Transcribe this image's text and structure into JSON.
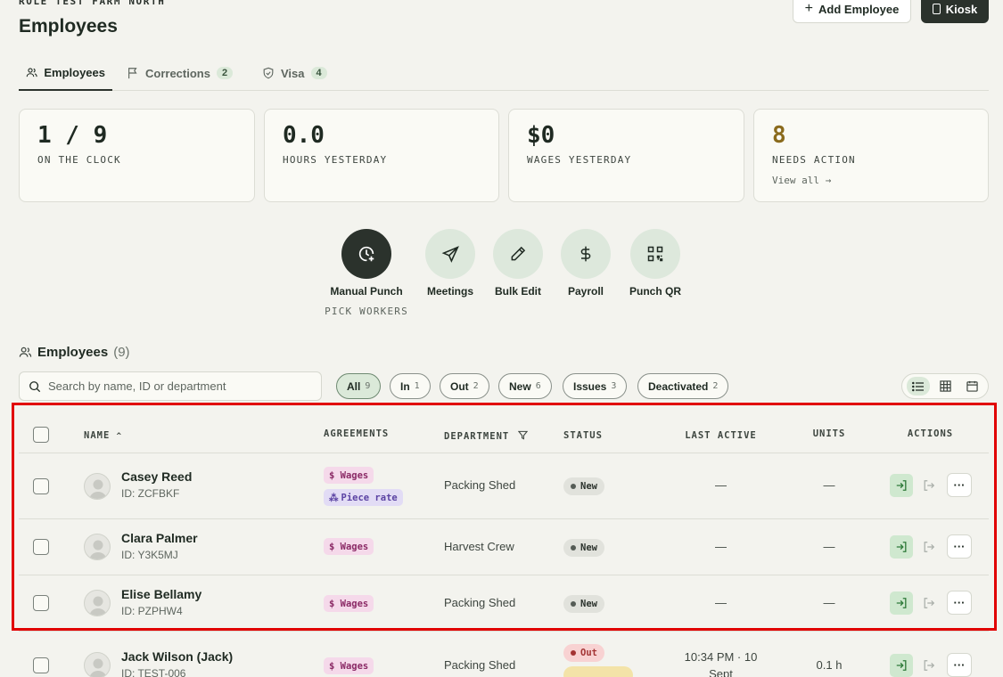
{
  "header": {
    "org": "ROLE TEST FARM NORTH",
    "title": "Employees",
    "add_employee": "Add Employee",
    "kiosk": "Kiosk"
  },
  "tabs": [
    {
      "label": "Employees",
      "icon": "people-icon"
    },
    {
      "label": "Corrections",
      "count": "2",
      "icon": "flag-icon"
    },
    {
      "label": "Visa",
      "count": "4",
      "icon": "shield-icon"
    }
  ],
  "stats": [
    {
      "value": "1 / 9",
      "label": "ON THE CLOCK"
    },
    {
      "value": "0.0",
      "label": "HOURS YESTERDAY"
    },
    {
      "value": "$0",
      "label": "WAGES YESTERDAY"
    },
    {
      "value": "8",
      "label": "NEEDS ACTION",
      "link": "View all →",
      "color": "#8a6a1c"
    }
  ],
  "actions": [
    {
      "label": "Manual Punch",
      "sub": "PICK WORKERS",
      "icon": "clock-plus-icon"
    },
    {
      "label": "Meetings",
      "icon": "send-icon"
    },
    {
      "label": "Bulk Edit",
      "icon": "pencil-icon"
    },
    {
      "label": "Payroll",
      "icon": "dollar-icon"
    },
    {
      "label": "Punch QR",
      "icon": "qr-code-icon"
    }
  ],
  "section": {
    "title": "Employees",
    "count": "(9)"
  },
  "search": {
    "placeholder": "Search by name, ID or department"
  },
  "filters": [
    {
      "label": "All",
      "count": "9"
    },
    {
      "label": "In",
      "count": "1"
    },
    {
      "label": "Out",
      "count": "2"
    },
    {
      "label": "New",
      "count": "6"
    },
    {
      "label": "Issues",
      "count": "3"
    },
    {
      "label": "Deactivated",
      "count": "2"
    }
  ],
  "table": {
    "headers": {
      "name": "NAME",
      "agreements": "AGREEMENTS",
      "department": "DEPARTMENT",
      "status": "STATUS",
      "last_active": "LAST ACTIVE",
      "units": "UNITS",
      "actions": "ACTIONS"
    },
    "rows": [
      {
        "name": "Casey Reed",
        "id": "ID: ZCFBKF",
        "wages": "$ Wages",
        "piece": "Piece rate",
        "department": "Packing Shed",
        "status": "New",
        "last_active": "—",
        "units": "—"
      },
      {
        "name": "Clara Palmer",
        "id": "ID: Y3K5MJ",
        "wages": "$ Wages",
        "department": "Harvest Crew",
        "status": "New",
        "last_active": "—",
        "units": "—"
      },
      {
        "name": "Elise Bellamy",
        "id": "ID: PZPHW4",
        "wages": "$ Wages",
        "department": "Packing Shed",
        "status": "New",
        "last_active": "—",
        "units": "—"
      },
      {
        "name": "Jack Wilson (Jack)",
        "id": "ID: TEST-006",
        "wages": "$ Wages",
        "department": "Packing Shed",
        "status": "Out",
        "last_active_1": "10:34 PM · 10",
        "last_active_2": "Sept",
        "units": "0.1 h"
      }
    ]
  },
  "colors": {
    "accent_dark": "#2b322c",
    "accent_green": "#dbe9d9",
    "highlight": "#e10000"
  }
}
